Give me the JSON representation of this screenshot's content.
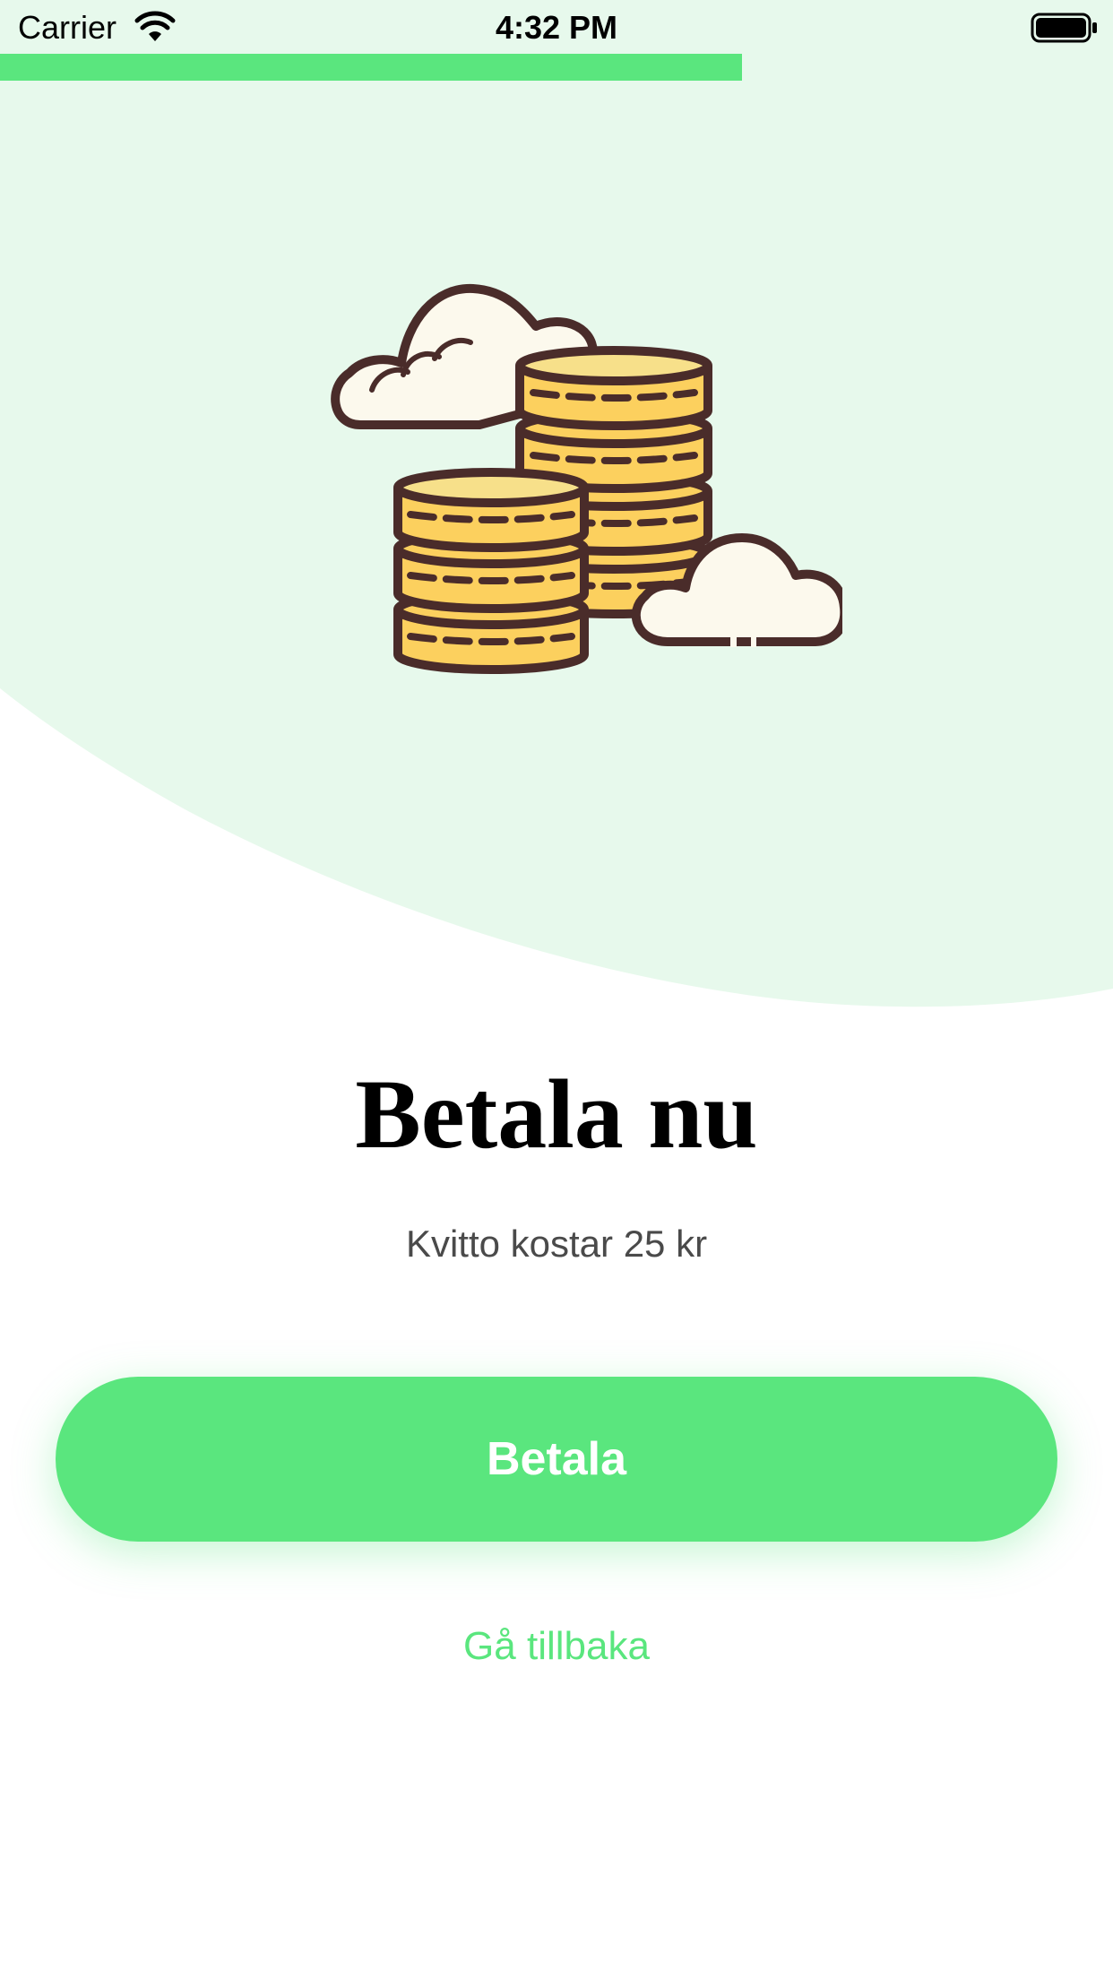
{
  "status_bar": {
    "carrier": "Carrier",
    "time": "4:32 PM",
    "wifi_icon": "wifi-icon",
    "battery_icon": "battery-icon"
  },
  "progress": {
    "fraction": 0.667,
    "color": "#5ae67e"
  },
  "illustration": {
    "icon": "coins-with-clouds-icon"
  },
  "main": {
    "title": "Betala nu",
    "subtitle": "Kvitto kostar 25 kr",
    "pay_button_label": "Betala",
    "back_link_label": "Gå tillbaka"
  },
  "colors": {
    "accent": "#5ae67e",
    "background_tint": "#e7f9ec",
    "coin": "#fcd05e",
    "outline": "#4a2c2a",
    "cloud": "#fcf9ed"
  }
}
